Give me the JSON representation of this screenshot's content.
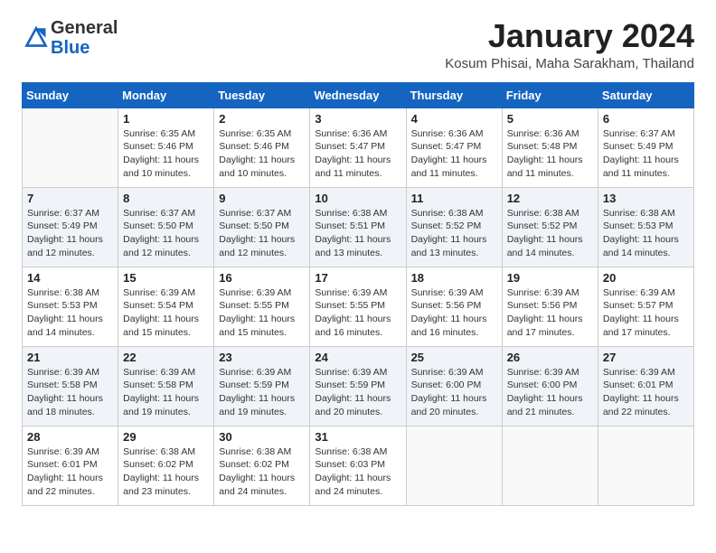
{
  "header": {
    "logo_general": "General",
    "logo_blue": "Blue",
    "month_title": "January 2024",
    "location": "Kosum Phisai, Maha Sarakham, Thailand"
  },
  "days_of_week": [
    "Sunday",
    "Monday",
    "Tuesday",
    "Wednesday",
    "Thursday",
    "Friday",
    "Saturday"
  ],
  "weeks": [
    [
      {
        "day": "",
        "lines": []
      },
      {
        "day": "1",
        "lines": [
          "Sunrise: 6:35 AM",
          "Sunset: 5:46 PM",
          "Daylight: 11 hours",
          "and 10 minutes."
        ]
      },
      {
        "day": "2",
        "lines": [
          "Sunrise: 6:35 AM",
          "Sunset: 5:46 PM",
          "Daylight: 11 hours",
          "and 10 minutes."
        ]
      },
      {
        "day": "3",
        "lines": [
          "Sunrise: 6:36 AM",
          "Sunset: 5:47 PM",
          "Daylight: 11 hours",
          "and 11 minutes."
        ]
      },
      {
        "day": "4",
        "lines": [
          "Sunrise: 6:36 AM",
          "Sunset: 5:47 PM",
          "Daylight: 11 hours",
          "and 11 minutes."
        ]
      },
      {
        "day": "5",
        "lines": [
          "Sunrise: 6:36 AM",
          "Sunset: 5:48 PM",
          "Daylight: 11 hours",
          "and 11 minutes."
        ]
      },
      {
        "day": "6",
        "lines": [
          "Sunrise: 6:37 AM",
          "Sunset: 5:49 PM",
          "Daylight: 11 hours",
          "and 11 minutes."
        ]
      }
    ],
    [
      {
        "day": "7",
        "lines": [
          "Sunrise: 6:37 AM",
          "Sunset: 5:49 PM",
          "Daylight: 11 hours",
          "and 12 minutes."
        ]
      },
      {
        "day": "8",
        "lines": [
          "Sunrise: 6:37 AM",
          "Sunset: 5:50 PM",
          "Daylight: 11 hours",
          "and 12 minutes."
        ]
      },
      {
        "day": "9",
        "lines": [
          "Sunrise: 6:37 AM",
          "Sunset: 5:50 PM",
          "Daylight: 11 hours",
          "and 12 minutes."
        ]
      },
      {
        "day": "10",
        "lines": [
          "Sunrise: 6:38 AM",
          "Sunset: 5:51 PM",
          "Daylight: 11 hours",
          "and 13 minutes."
        ]
      },
      {
        "day": "11",
        "lines": [
          "Sunrise: 6:38 AM",
          "Sunset: 5:52 PM",
          "Daylight: 11 hours",
          "and 13 minutes."
        ]
      },
      {
        "day": "12",
        "lines": [
          "Sunrise: 6:38 AM",
          "Sunset: 5:52 PM",
          "Daylight: 11 hours",
          "and 14 minutes."
        ]
      },
      {
        "day": "13",
        "lines": [
          "Sunrise: 6:38 AM",
          "Sunset: 5:53 PM",
          "Daylight: 11 hours",
          "and 14 minutes."
        ]
      }
    ],
    [
      {
        "day": "14",
        "lines": [
          "Sunrise: 6:38 AM",
          "Sunset: 5:53 PM",
          "Daylight: 11 hours",
          "and 14 minutes."
        ]
      },
      {
        "day": "15",
        "lines": [
          "Sunrise: 6:39 AM",
          "Sunset: 5:54 PM",
          "Daylight: 11 hours",
          "and 15 minutes."
        ]
      },
      {
        "day": "16",
        "lines": [
          "Sunrise: 6:39 AM",
          "Sunset: 5:55 PM",
          "Daylight: 11 hours",
          "and 15 minutes."
        ]
      },
      {
        "day": "17",
        "lines": [
          "Sunrise: 6:39 AM",
          "Sunset: 5:55 PM",
          "Daylight: 11 hours",
          "and 16 minutes."
        ]
      },
      {
        "day": "18",
        "lines": [
          "Sunrise: 6:39 AM",
          "Sunset: 5:56 PM",
          "Daylight: 11 hours",
          "and 16 minutes."
        ]
      },
      {
        "day": "19",
        "lines": [
          "Sunrise: 6:39 AM",
          "Sunset: 5:56 PM",
          "Daylight: 11 hours",
          "and 17 minutes."
        ]
      },
      {
        "day": "20",
        "lines": [
          "Sunrise: 6:39 AM",
          "Sunset: 5:57 PM",
          "Daylight: 11 hours",
          "and 17 minutes."
        ]
      }
    ],
    [
      {
        "day": "21",
        "lines": [
          "Sunrise: 6:39 AM",
          "Sunset: 5:58 PM",
          "Daylight: 11 hours",
          "and 18 minutes."
        ]
      },
      {
        "day": "22",
        "lines": [
          "Sunrise: 6:39 AM",
          "Sunset: 5:58 PM",
          "Daylight: 11 hours",
          "and 19 minutes."
        ]
      },
      {
        "day": "23",
        "lines": [
          "Sunrise: 6:39 AM",
          "Sunset: 5:59 PM",
          "Daylight: 11 hours",
          "and 19 minutes."
        ]
      },
      {
        "day": "24",
        "lines": [
          "Sunrise: 6:39 AM",
          "Sunset: 5:59 PM",
          "Daylight: 11 hours",
          "and 20 minutes."
        ]
      },
      {
        "day": "25",
        "lines": [
          "Sunrise: 6:39 AM",
          "Sunset: 6:00 PM",
          "Daylight: 11 hours",
          "and 20 minutes."
        ]
      },
      {
        "day": "26",
        "lines": [
          "Sunrise: 6:39 AM",
          "Sunset: 6:00 PM",
          "Daylight: 11 hours",
          "and 21 minutes."
        ]
      },
      {
        "day": "27",
        "lines": [
          "Sunrise: 6:39 AM",
          "Sunset: 6:01 PM",
          "Daylight: 11 hours",
          "and 22 minutes."
        ]
      }
    ],
    [
      {
        "day": "28",
        "lines": [
          "Sunrise: 6:39 AM",
          "Sunset: 6:01 PM",
          "Daylight: 11 hours",
          "and 22 minutes."
        ]
      },
      {
        "day": "29",
        "lines": [
          "Sunrise: 6:38 AM",
          "Sunset: 6:02 PM",
          "Daylight: 11 hours",
          "and 23 minutes."
        ]
      },
      {
        "day": "30",
        "lines": [
          "Sunrise: 6:38 AM",
          "Sunset: 6:02 PM",
          "Daylight: 11 hours",
          "and 24 minutes."
        ]
      },
      {
        "day": "31",
        "lines": [
          "Sunrise: 6:38 AM",
          "Sunset: 6:03 PM",
          "Daylight: 11 hours",
          "and 24 minutes."
        ]
      },
      {
        "day": "",
        "lines": []
      },
      {
        "day": "",
        "lines": []
      },
      {
        "day": "",
        "lines": []
      }
    ]
  ]
}
